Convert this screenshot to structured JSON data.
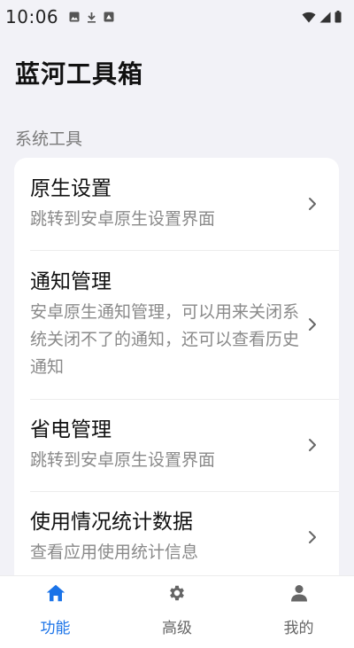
{
  "status_bar": {
    "time": "10:06",
    "left_icons": [
      "image-icon",
      "download-icon",
      "cast-icon"
    ],
    "right_icons": [
      "wifi-icon",
      "signal-icon",
      "battery-icon"
    ]
  },
  "header": {
    "title": "蓝河工具箱"
  },
  "section": {
    "label": "系统工具"
  },
  "items": [
    {
      "title": "原生设置",
      "desc": "跳转到安卓原生设置界面"
    },
    {
      "title": "通知管理",
      "desc": "安卓原生通知管理，可以用来关闭系统关闭不了的通知，还可以查看历史通知"
    },
    {
      "title": "省电管理",
      "desc": "跳转到安卓原生设置界面"
    },
    {
      "title": "使用情况统计数据",
      "desc": "查看应用使用统计信息"
    }
  ],
  "nav": {
    "items": [
      {
        "label": "功能",
        "icon": "home-icon"
      },
      {
        "label": "高级",
        "icon": "gear-icon"
      },
      {
        "label": "我的",
        "icon": "person-icon"
      }
    ],
    "active_index": 0
  },
  "colors": {
    "accent": "#1a73e8",
    "inactive": "#666666",
    "background": "#f2f2f7",
    "card": "#ffffff"
  }
}
